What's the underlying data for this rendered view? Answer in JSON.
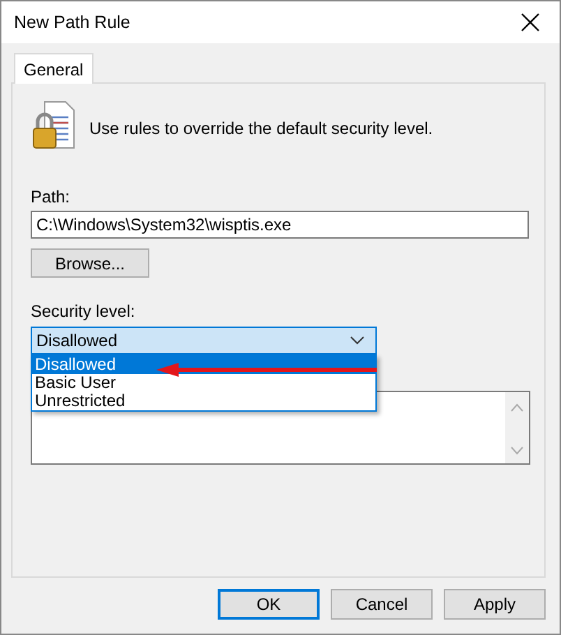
{
  "window": {
    "title": "New Path Rule"
  },
  "tabs": [
    {
      "label": "General",
      "selected": true
    }
  ],
  "intro": "Use rules to override the default security level.",
  "path": {
    "label": "Path:",
    "value": "C:\\Windows\\System32\\wisptis.exe"
  },
  "browse_button": "Browse...",
  "security_level": {
    "label": "Security level:",
    "value": "Disallowed",
    "expanded": true,
    "options": [
      {
        "label": "Disallowed",
        "selected": true
      },
      {
        "label": "Basic User",
        "selected": false
      },
      {
        "label": "Unrestricted",
        "selected": false
      }
    ]
  },
  "buttons": [
    {
      "label": "OK",
      "default": true
    },
    {
      "label": "Cancel",
      "default": false
    },
    {
      "label": "Apply",
      "default": false
    }
  ]
}
